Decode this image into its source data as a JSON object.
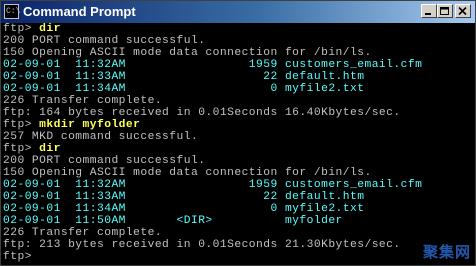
{
  "window": {
    "title": "Command Prompt",
    "icon_text": "C:\\"
  },
  "console": {
    "lines": [
      {
        "prompt": "ftp> ",
        "cmd": "dir"
      },
      {
        "text": "200 PORT command successful."
      },
      {
        "text": "150 Opening ASCII mode data connection for /bin/ls."
      },
      {
        "entry": "02-09-01  11:32AM                 1959 customers_email.cfm"
      },
      {
        "entry": "02-09-01  11:33AM                   22 default.htm"
      },
      {
        "entry": "02-09-01  11:34AM                    0 myfile2.txt"
      },
      {
        "text": "226 Transfer complete."
      },
      {
        "text": "ftp: 164 bytes received in 0.01Seconds 16.40Kbytes/sec."
      },
      {
        "prompt": "ftp> ",
        "cmd": "mkdir myfolder"
      },
      {
        "text": "257 MKD command successful."
      },
      {
        "prompt": "ftp> ",
        "cmd": "dir"
      },
      {
        "text": "200 PORT command successful."
      },
      {
        "text": "150 Opening ASCII mode data connection for /bin/ls."
      },
      {
        "entry": "02-09-01  11:32AM                 1959 customers_email.cfm"
      },
      {
        "entry": "02-09-01  11:33AM                   22 default.htm"
      },
      {
        "entry": "02-09-01  11:34AM                    0 myfile2.txt"
      },
      {
        "entry": "02-09-01  11:50AM       <DIR>          myfolder"
      },
      {
        "text": "226 Transfer complete."
      },
      {
        "text": "ftp: 213 bytes received in 0.01Seconds 21.30Kbytes/sec."
      },
      {
        "prompt": "ftp> ",
        "cmd": ""
      }
    ]
  },
  "watermark": "聚集网",
  "colors": {
    "title_bar_start": "#0a246a",
    "title_bar_end": "#a6caf0",
    "console_background": "#000000",
    "output_text": "#c0c0c0",
    "command_text": "#ffff55",
    "listing_text": "#55ffff"
  }
}
